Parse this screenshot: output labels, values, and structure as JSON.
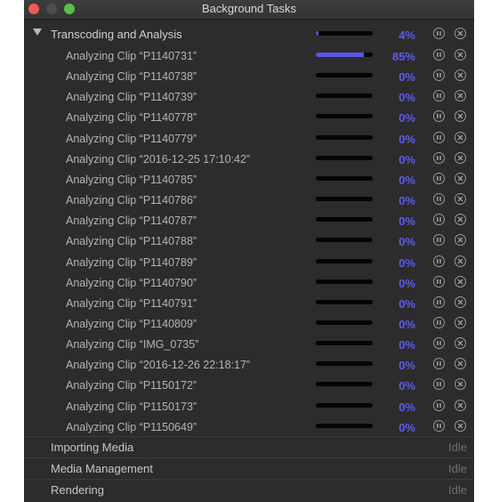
{
  "window": {
    "title": "Background Tasks"
  },
  "group": {
    "label": "Transcoding and Analysis",
    "progress_percent": 4,
    "percent_label": "4%"
  },
  "tasks": [
    {
      "label": "Analyzing Clip “P1140731”",
      "progress_percent": 85,
      "percent_label": "85%"
    },
    {
      "label": "Analyzing Clip “P1140738”",
      "progress_percent": 0,
      "percent_label": "0%"
    },
    {
      "label": "Analyzing Clip “P1140739”",
      "progress_percent": 0,
      "percent_label": "0%"
    },
    {
      "label": "Analyzing Clip “P1140778”",
      "progress_percent": 0,
      "percent_label": "0%"
    },
    {
      "label": "Analyzing Clip “P1140779”",
      "progress_percent": 0,
      "percent_label": "0%"
    },
    {
      "label": "Analyzing Clip “2016-12-25 17:10:42”",
      "progress_percent": 0,
      "percent_label": "0%"
    },
    {
      "label": "Analyzing Clip “P1140785”",
      "progress_percent": 0,
      "percent_label": "0%"
    },
    {
      "label": "Analyzing Clip “P1140786”",
      "progress_percent": 0,
      "percent_label": "0%"
    },
    {
      "label": "Analyzing Clip “P1140787”",
      "progress_percent": 0,
      "percent_label": "0%"
    },
    {
      "label": "Analyzing Clip “P1140788”",
      "progress_percent": 0,
      "percent_label": "0%"
    },
    {
      "label": "Analyzing Clip “P1140789”",
      "progress_percent": 0,
      "percent_label": "0%"
    },
    {
      "label": "Analyzing Clip “P1140790”",
      "progress_percent": 0,
      "percent_label": "0%"
    },
    {
      "label": "Analyzing Clip “P1140791”",
      "progress_percent": 0,
      "percent_label": "0%"
    },
    {
      "label": "Analyzing Clip “P1140809”",
      "progress_percent": 0,
      "percent_label": "0%"
    },
    {
      "label": "Analyzing Clip “IMG_0735”",
      "progress_percent": 0,
      "percent_label": "0%"
    },
    {
      "label": "Analyzing Clip “2016-12-26 22:18:17”",
      "progress_percent": 0,
      "percent_label": "0%"
    },
    {
      "label": "Analyzing Clip “P1150172”",
      "progress_percent": 0,
      "percent_label": "0%"
    },
    {
      "label": "Analyzing Clip “P1150173”",
      "progress_percent": 0,
      "percent_label": "0%"
    },
    {
      "label": "Analyzing Clip “P1150649”",
      "progress_percent": 0,
      "percent_label": "0%"
    }
  ],
  "sections": [
    {
      "label": "Importing Media",
      "status": "Idle"
    },
    {
      "label": "Media Management",
      "status": "Idle"
    },
    {
      "label": "Rendering",
      "status": "Idle"
    }
  ],
  "colors": {
    "progress_fill": "#5a55e8",
    "percent_text": "#5f5aee",
    "close_button": "#ee5a52",
    "zoom_button": "#58c147",
    "window_background": "#2c2c2c"
  },
  "icons": {
    "pause": "pause-circle-icon",
    "cancel": "cancel-circle-icon",
    "disclosure": "disclosure-triangle-icon"
  }
}
